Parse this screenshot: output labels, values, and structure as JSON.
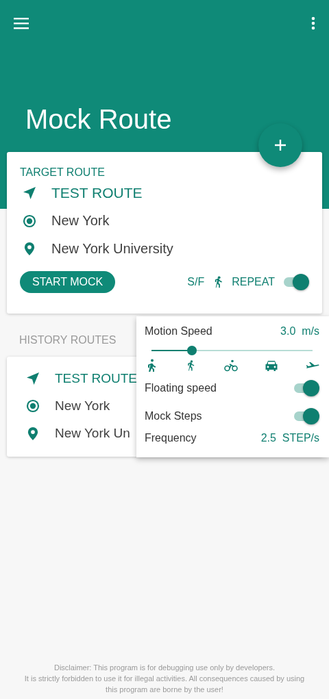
{
  "app_bar": {
    "title": "Mock Route"
  },
  "target_route": {
    "heading": "TARGET ROUTE",
    "name": "TEST ROUTE",
    "start": "New York",
    "end": "New York University",
    "start_button": "START MOCK",
    "sf_label": "S/F",
    "repeat_label": "REPEAT",
    "repeat_on": true
  },
  "history": {
    "heading": "HISTORY ROUTES",
    "routes": [
      {
        "name": "TEST ROUTE",
        "start": "New York",
        "end": "New York Un"
      }
    ]
  },
  "speed_panel": {
    "label": "Motion Speed",
    "value": "3.0",
    "unit": "m/s",
    "level": 0.25,
    "modes": [
      {
        "kind": "walk"
      },
      {
        "kind": "run"
      },
      {
        "kind": "bike"
      },
      {
        "kind": "car"
      },
      {
        "kind": "plane"
      }
    ],
    "toggles": [
      {
        "label": "Floating speed",
        "on": true
      },
      {
        "label": "Mock Steps",
        "on": true
      }
    ],
    "frequency_label": "Frequency",
    "frequency_value": "2.5",
    "frequency_unit": "STEP/s"
  },
  "disclaimer": [
    "Disclaimer: This program is for debugging use only by developers.",
    "It is strictly forbidden to use it for illegal activities. All consequences caused by using",
    "this program are borne by the user!"
  ]
}
